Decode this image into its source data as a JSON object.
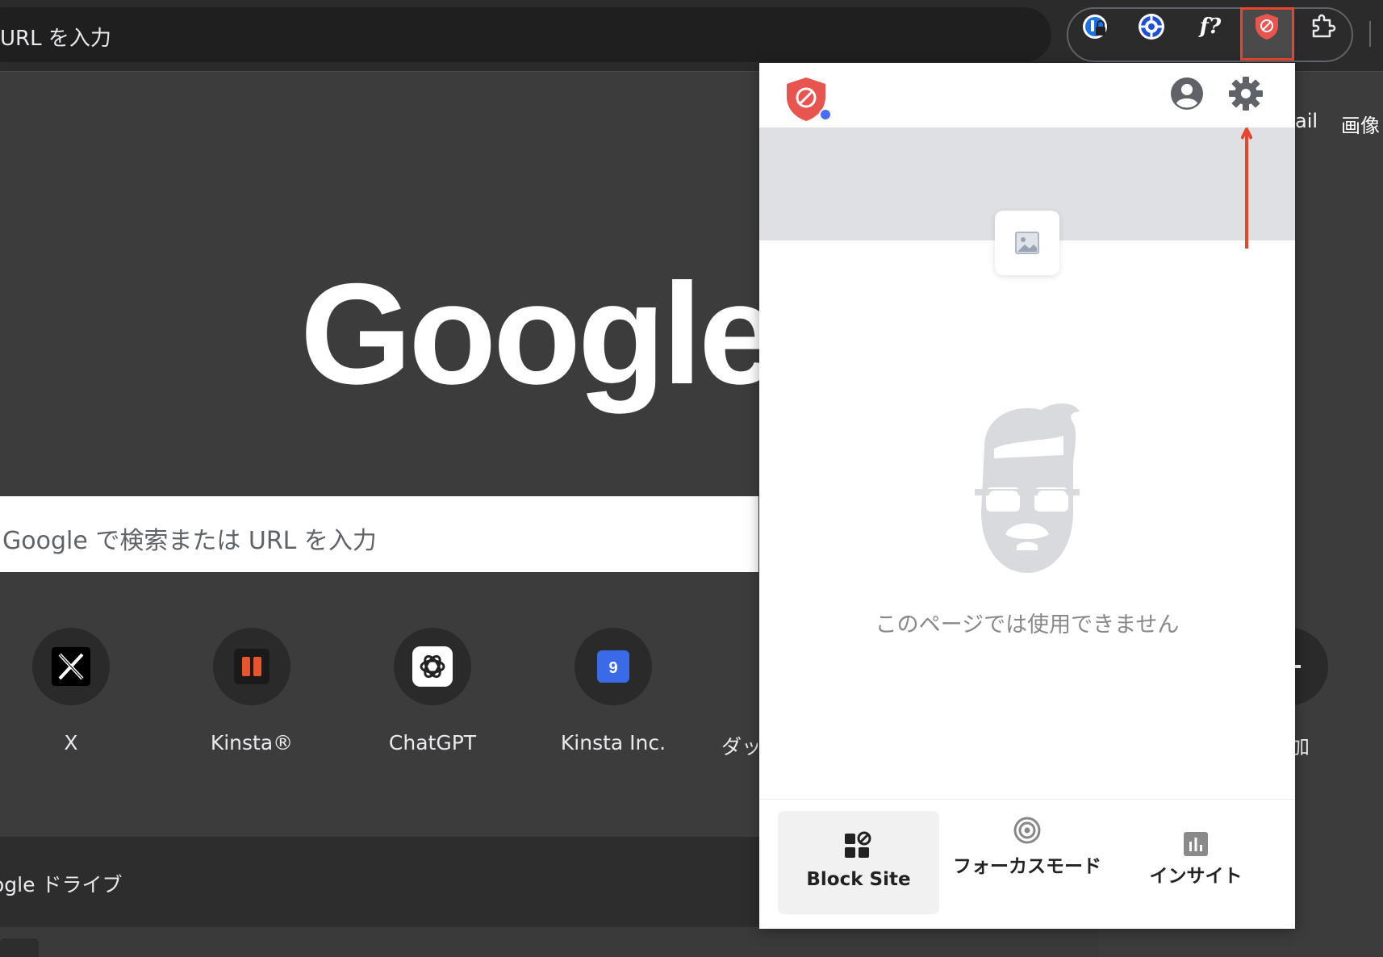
{
  "toolbar": {
    "omnibox_text": "URL を入力",
    "extensions": [
      "password-manager-icon",
      "settings-badge-icon",
      "font-finder-icon",
      "blocksite-icon",
      "puzzle-extensions-icon"
    ],
    "font_ext_label": "f?"
  },
  "ntp": {
    "header_links": [
      "ail",
      "画像"
    ],
    "logo": "Google",
    "search_placeholder": "Google で検索または URL を入力",
    "shortcuts": [
      {
        "label": "X"
      },
      {
        "label": "Kinsta®"
      },
      {
        "label": "ChatGPT"
      },
      {
        "label": "Kinsta Inc."
      },
      {
        "label": "ダッ"
      }
    ],
    "add_label": "追加",
    "drive_label": "ogle ドライブ"
  },
  "popup": {
    "unavailable_text": "このページでは使用できません",
    "tabs": [
      {
        "label": "Block Site",
        "active": true
      },
      {
        "label": "フォーカスモード",
        "active": false
      },
      {
        "label": "インサイト",
        "active": false
      }
    ],
    "accent_color": "#e8554e",
    "status_dot_color": "#4a6cf7"
  },
  "annotation": {
    "highlight_color": "#e8452c"
  }
}
